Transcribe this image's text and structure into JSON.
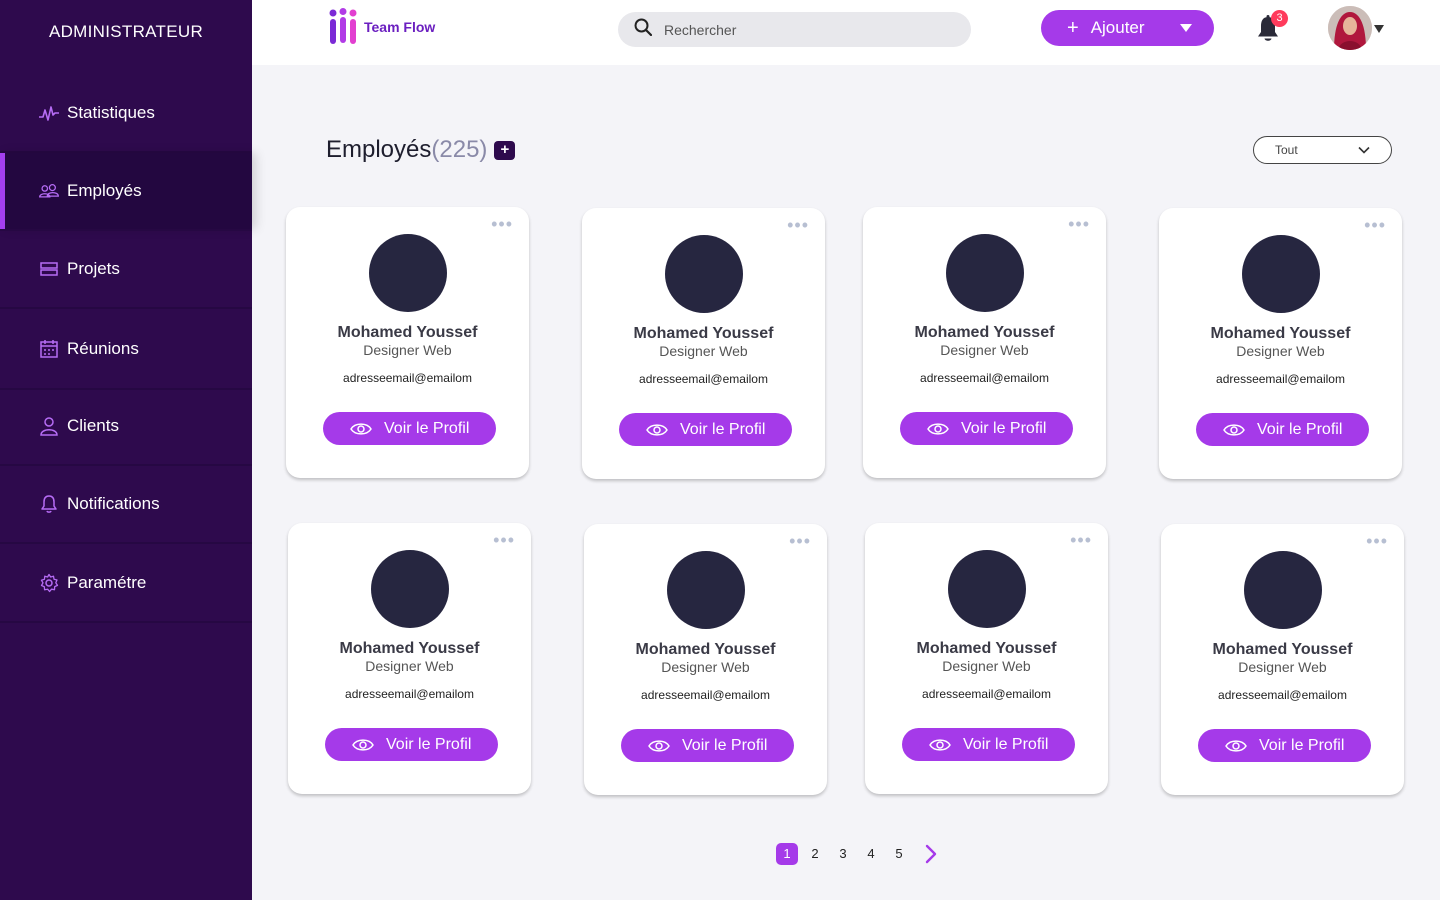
{
  "sidebar": {
    "brand": "ADMINISTRATEUR",
    "items": [
      {
        "label": "Statistiques",
        "icon": "activity-icon"
      },
      {
        "label": "Employés",
        "icon": "users-icon"
      },
      {
        "label": "Projets",
        "icon": "layers-icon"
      },
      {
        "label": "Réunions",
        "icon": "calendar-icon"
      },
      {
        "label": "Clients",
        "icon": "user-icon"
      },
      {
        "label": "Notifications",
        "icon": "bell-icon"
      },
      {
        "label": "Paramétre",
        "icon": "gear-icon"
      }
    ],
    "active_index": 1
  },
  "header": {
    "logo_text": "Team Flow",
    "search_placeholder": "Rechercher",
    "add_label": "Ajouter",
    "notification_count": "3"
  },
  "main": {
    "title": "Employés",
    "count": "(225)",
    "add_symbol": "+",
    "filter_value": "Tout",
    "view_profile_label": "Voir le Profil",
    "employees": [
      {
        "name": "Mohamed Youssef",
        "role": "Designer Web",
        "email": "adresseemail@emailom"
      },
      {
        "name": "Mohamed Youssef",
        "role": "Designer Web",
        "email": "adresseemail@emailom"
      },
      {
        "name": "Mohamed Youssef",
        "role": "Designer Web",
        "email": "adresseemail@emailom"
      },
      {
        "name": "Mohamed Youssef",
        "role": "Designer Web",
        "email": "adresseemail@emailom"
      },
      {
        "name": "Mohamed Youssef",
        "role": "Designer Web",
        "email": "adresseemail@emailom"
      },
      {
        "name": "Mohamed Youssef",
        "role": "Designer Web",
        "email": "adresseemail@emailom"
      },
      {
        "name": "Mohamed Youssef",
        "role": "Designer Web",
        "email": "adresseemail@emailom"
      },
      {
        "name": "Mohamed Youssef",
        "role": "Designer Web",
        "email": "adresseemail@emailom"
      }
    ]
  },
  "pagination": {
    "pages": [
      "1",
      "2",
      "3",
      "4",
      "5"
    ],
    "current": "1"
  },
  "colors": {
    "sidebar_bg": "#2e0a4d",
    "accent": "#a53ae9",
    "avatar_placeholder": "#262640",
    "badge": "#ff3b5c"
  }
}
